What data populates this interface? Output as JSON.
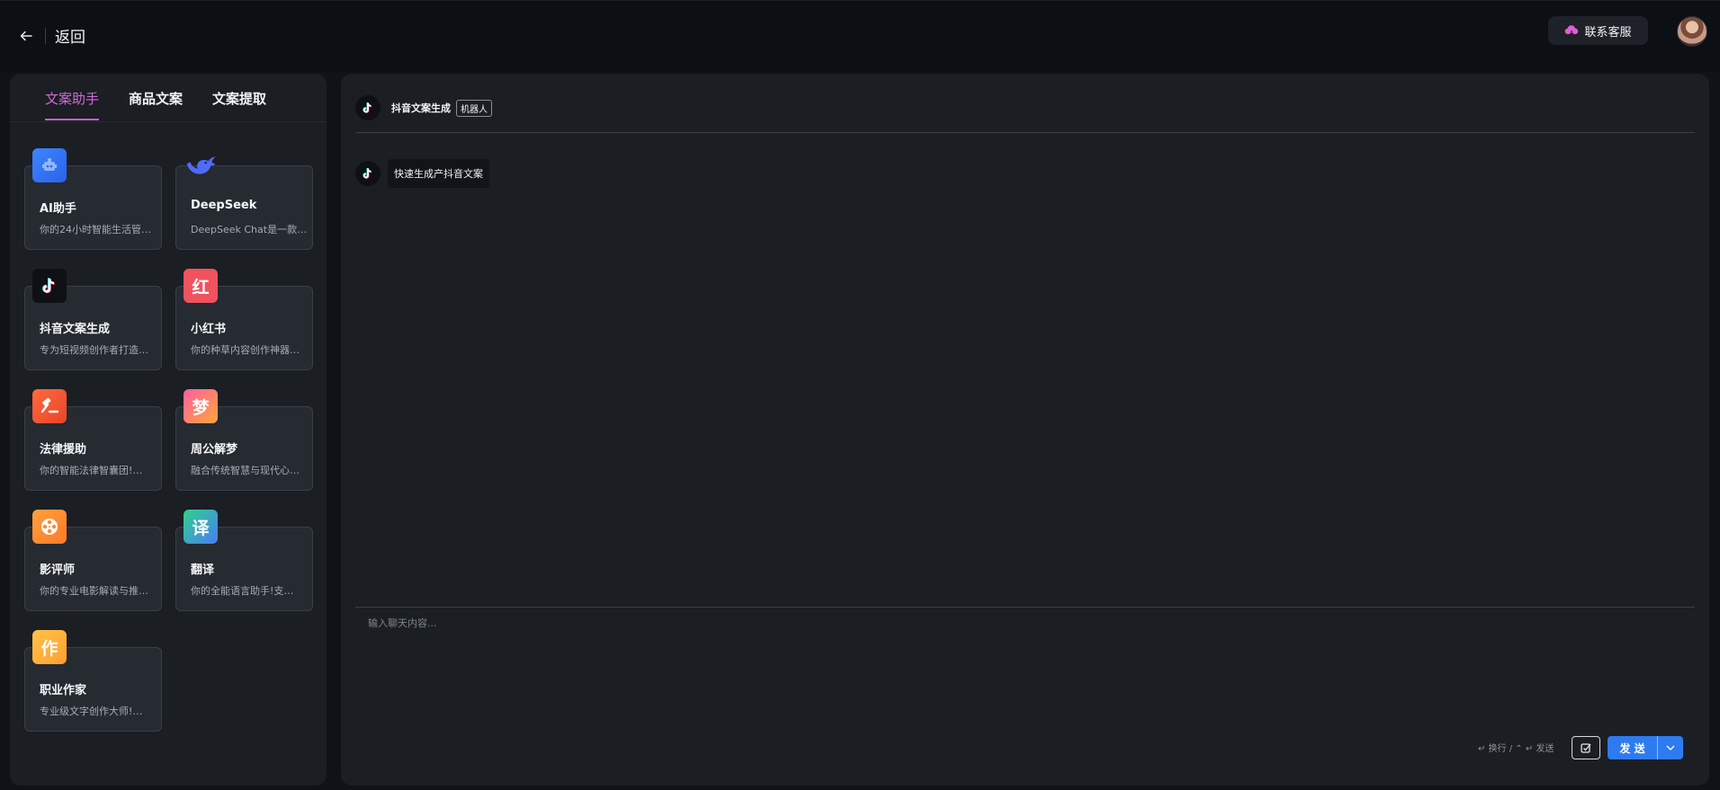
{
  "header": {
    "back_label": "返回",
    "support_label": "联系客服"
  },
  "tabs": [
    {
      "label": "文案助手",
      "active": true
    },
    {
      "label": "商品文案",
      "active": false
    },
    {
      "label": "文案提取",
      "active": false
    }
  ],
  "assistants": [
    {
      "title": "AI助手",
      "desc": "你的24小时智能生活管…",
      "icon": "robot-icon"
    },
    {
      "title": "DeepSeek",
      "desc": "DeepSeek Chat是一款…",
      "icon": "deepseek-whale-icon"
    },
    {
      "title": "抖音文案生成",
      "desc": "专为短视频创作者打造…",
      "icon": "tiktok-icon"
    },
    {
      "title": "小红书",
      "desc": "你的种草内容创作神器…",
      "icon": "xiaohongshu-icon",
      "glyph": "红"
    },
    {
      "title": "法律援助",
      "desc": "你的智能法律智囊团!…",
      "icon": "gavel-icon"
    },
    {
      "title": "周公解梦",
      "desc": "融合传统智慧与现代心…",
      "icon": "dream-icon",
      "glyph": "梦"
    },
    {
      "title": "影评师",
      "desc": "你的专业电影解读与推…",
      "icon": "film-reel-icon"
    },
    {
      "title": "翻译",
      "desc": "你的全能语言助手!支…",
      "icon": "translate-icon",
      "glyph": "译"
    },
    {
      "title": "职业作家",
      "desc": "专业级文字创作大师!…",
      "icon": "writer-icon",
      "glyph": "作"
    }
  ],
  "chat": {
    "bot_name": "抖音文案生成",
    "bot_tag": "机器人",
    "messages": [
      {
        "role": "bot",
        "text": "快速生成产抖音文案"
      }
    ],
    "input_placeholder": "输入聊天内容...",
    "hint": "↵ 换行 / ⌃ ↵ 发送",
    "send_label": "发 送"
  },
  "colors": {
    "accent_tab": "#c55ed0",
    "send_button": "#2e7bf0",
    "panel_bg": "#1b1e23",
    "page_bg": "#0f1216"
  }
}
